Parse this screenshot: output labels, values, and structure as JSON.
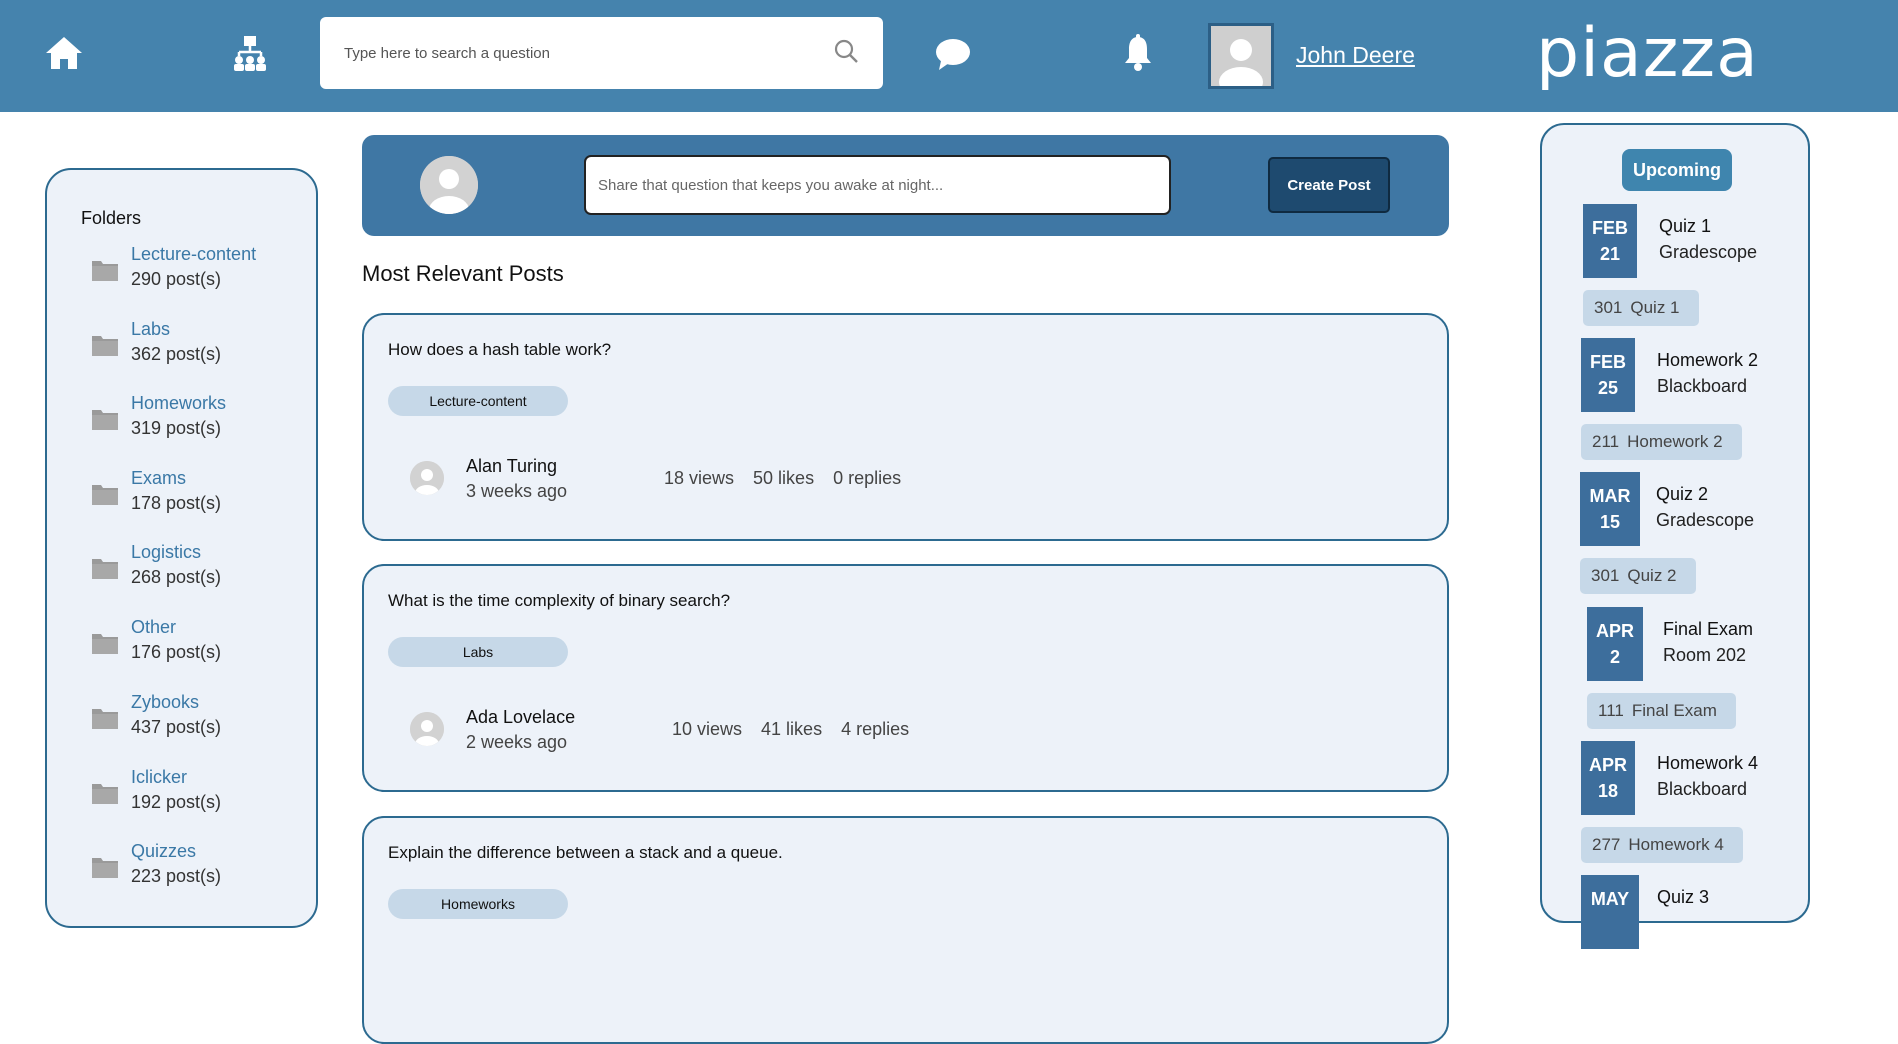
{
  "header": {
    "search_placeholder": "Type here to search a question",
    "user_name": "John Deere",
    "logo_text": "piazza",
    "accent": "#4583ad"
  },
  "folders": {
    "title": "Folders",
    "items": [
      {
        "name": "Lecture-content",
        "count": "290 post(s)"
      },
      {
        "name": "Labs",
        "count": "362 post(s)"
      },
      {
        "name": "Homeworks",
        "count": "319 post(s)"
      },
      {
        "name": "Exams",
        "count": "178 post(s)"
      },
      {
        "name": "Logistics",
        "count": "268 post(s)"
      },
      {
        "name": "Other",
        "count": "176 post(s)"
      },
      {
        "name": "Zybooks",
        "count": "437 post(s)"
      },
      {
        "name": "Iclicker",
        "count": "192 post(s)"
      },
      {
        "name": "Quizzes",
        "count": "223 post(s)"
      }
    ]
  },
  "composer": {
    "placeholder": "Share that question that keeps you awake at night...",
    "create_label": "Create Post"
  },
  "main": {
    "section_title": "Most Relevant Posts",
    "posts": [
      {
        "question": "How does a hash table work?",
        "tag": "Lecture-content",
        "author": "Alan Turing",
        "ago": "3 weeks ago",
        "views": "18 views",
        "likes": "50 likes",
        "replies": "0 replies"
      },
      {
        "question": "What is the time complexity of binary search?",
        "tag": "Labs",
        "author": "Ada Lovelace",
        "ago": "2 weeks ago",
        "views": "10 views",
        "likes": "41 likes",
        "replies": "4 replies"
      },
      {
        "question": "Explain the difference between a stack and a queue.",
        "tag": "Homeworks"
      }
    ]
  },
  "upcoming": {
    "title": "Upcoming",
    "events": [
      {
        "month": "FEB",
        "day": "21",
        "title": "Quiz 1",
        "sub": "Gradescope",
        "course": "301",
        "chip": "Quiz 1"
      },
      {
        "month": "FEB",
        "day": "25",
        "title": "Homework 2",
        "sub": "Blackboard",
        "course": "211",
        "chip": "Homework 2"
      },
      {
        "month": "MAR",
        "day": "15",
        "title": "Quiz 2",
        "sub": "Gradescope",
        "course": "301",
        "chip": "Quiz 2"
      },
      {
        "month": "APR",
        "day": "2",
        "title": "Final Exam",
        "sub": "Room 202",
        "course": "111",
        "chip": "Final Exam"
      },
      {
        "month": "APR",
        "day": "18",
        "title": "Homework 4",
        "sub": "Blackboard",
        "course": "277",
        "chip": "Homework 4"
      },
      {
        "month": "MAY",
        "day": "",
        "title": "Quiz 3",
        "sub": ""
      }
    ]
  }
}
